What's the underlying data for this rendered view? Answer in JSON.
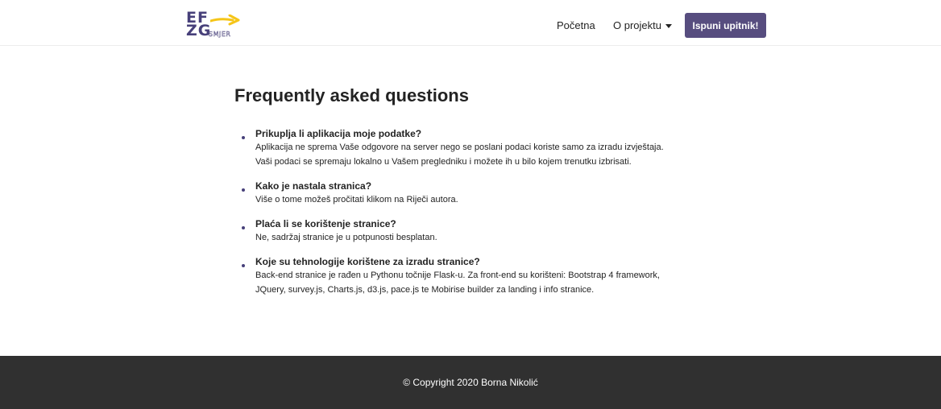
{
  "header": {
    "logo": {
      "top": "EF",
      "bottom": "ZG",
      "tag": "SMJER"
    },
    "nav": {
      "home": "Početna",
      "project": "O projektu",
      "cta": "Ispuni upitnik!"
    }
  },
  "main": {
    "title": "Frequently asked questions",
    "faqs": [
      {
        "question": "Prikuplja li aplikacija moje podatke?",
        "answer_lines": [
          "Aplikacija ne sprema Vaše odgovore na server nego se poslani podaci koriste samo za izradu izvještaja.",
          "Vaši podaci se spremaju lokalno u Vašem pregledniku i možete ih u bilo kojem trenutku izbrisati."
        ]
      },
      {
        "question": "Kako je nastala stranica?",
        "answer_lines": [
          "Više o tome možeš pročitati klikom na Riječi autora."
        ]
      },
      {
        "question": "Plaća li se korištenje stranice?",
        "answer_lines": [
          "Ne, sadržaj stranice je u potpunosti besplatan."
        ]
      },
      {
        "question": "Koje su tehnologije korištene za izradu stranice?",
        "answer_lines": [
          "Back-end stranice je rađen u Pythonu točnije Flask-u. Za front-end su korišteni: Bootstrap 4 framework,",
          "JQuery, survey.js, Charts.js, d3.js, pace.js te Mobirise builder za landing i info stranice."
        ]
      }
    ]
  },
  "footer": {
    "copyright": "© Copyright 2020 Borna Nikolić"
  },
  "colors": {
    "brand": "#47407a",
    "cta": "#574d7f",
    "accent_arrow": "#f5c518",
    "footer_bg": "#303030"
  },
  "icons": {
    "logo_arrow": "arrow-right-icon",
    "dropdown": "caret-down-icon",
    "bullet": "bullet-dot-icon"
  }
}
